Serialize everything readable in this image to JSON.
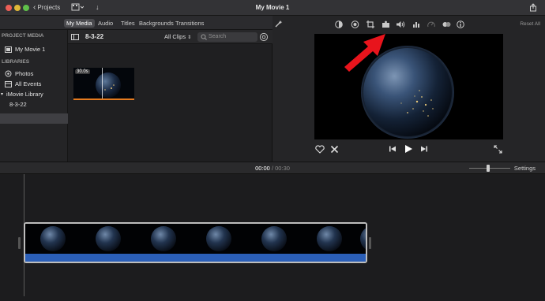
{
  "titlebar": {
    "back_label": "Projects",
    "movie_title": "My Movie 1"
  },
  "browser": {
    "tabs": [
      "My Media",
      "Audio",
      "Titles",
      "Backgrounds",
      "Transitions"
    ],
    "active_tab": "My Media",
    "sidebar": {
      "project_header": "PROJECT MEDIA",
      "project_item": "My Movie 1",
      "libraries_header": "LIBRARIES",
      "items": [
        "Photos",
        "All Events",
        "iMovie Library",
        "8-3-22"
      ],
      "selected": "8-3-22"
    },
    "media": {
      "event_name": "8-3-22",
      "filter_label": "All Clips",
      "search_placeholder": "Search",
      "clip_duration": "30.0s"
    }
  },
  "viewer": {
    "reset_label": "Reset All"
  },
  "timeline": {
    "current_time": "00:00",
    "separator": "/",
    "total_time": "00:30",
    "settings_label": "Settings"
  },
  "colors": {
    "accent_blue": "#2b5fb8",
    "clip_orange": "#e47a1f",
    "arrow_red": "#e8141c"
  }
}
